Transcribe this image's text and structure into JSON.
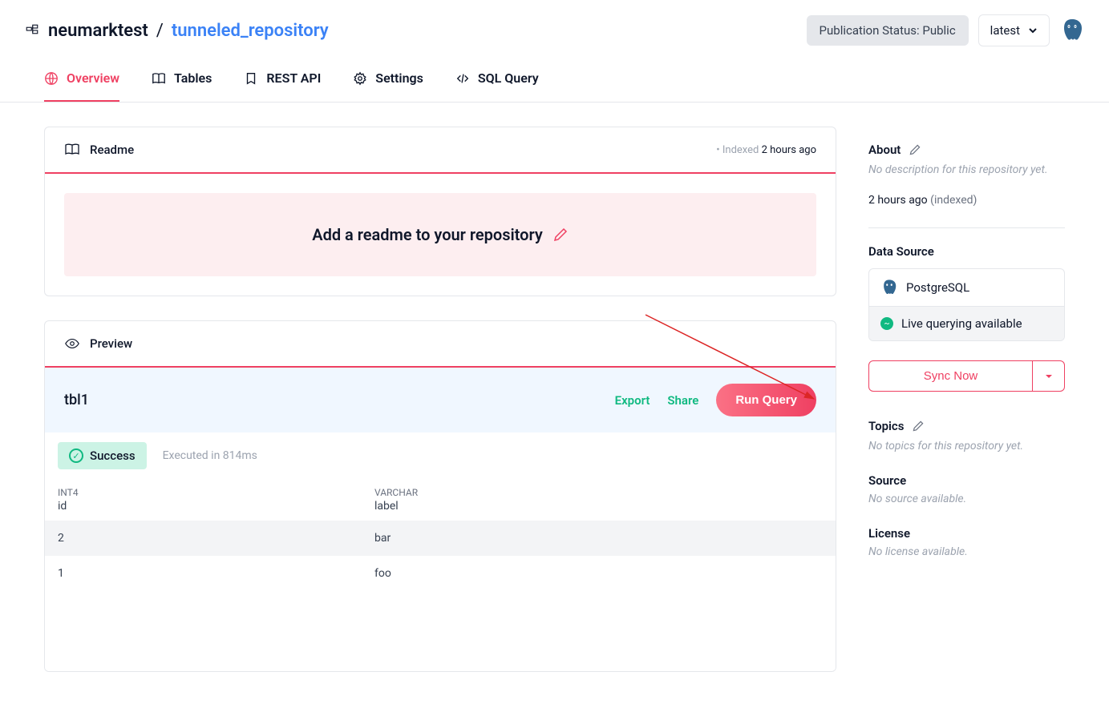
{
  "breadcrumb": {
    "owner": "neumarktest",
    "repo": "tunneled_repository"
  },
  "header": {
    "publication_status": "Publication Status: Public",
    "version": "latest"
  },
  "tabs": {
    "overview": "Overview",
    "tables": "Tables",
    "rest_api": "REST API",
    "settings": "Settings",
    "sql_query": "SQL Query",
    "active": "overview"
  },
  "readme_card": {
    "title": "Readme",
    "indexed_label": "Indexed",
    "indexed_time": "2 hours ago",
    "banner_text": "Add a readme to your repository"
  },
  "preview_card": {
    "title": "Preview",
    "table_name": "tbl1",
    "export": "Export",
    "share": "Share",
    "run_query": "Run Query",
    "success_label": "Success",
    "exec_time": "Executed in 814ms",
    "columns": [
      {
        "type": "INT4",
        "name": "id"
      },
      {
        "type": "VARCHAR",
        "name": "label"
      }
    ],
    "rows": [
      {
        "id": "2",
        "label": "bar"
      },
      {
        "id": "1",
        "label": "foo"
      }
    ]
  },
  "sidebar": {
    "about": {
      "title": "About",
      "empty": "No description for this repository yet.",
      "indexed_time": "2 hours ago",
      "indexed_suffix": "(indexed)"
    },
    "data_source": {
      "title": "Data Source",
      "name": "PostgreSQL",
      "live_text": "Live querying available",
      "sync_now": "Sync Now"
    },
    "topics": {
      "title": "Topics",
      "empty": "No topics for this repository yet."
    },
    "source": {
      "title": "Source",
      "empty": "No source available."
    },
    "license": {
      "title": "License",
      "empty": "No license available."
    }
  }
}
